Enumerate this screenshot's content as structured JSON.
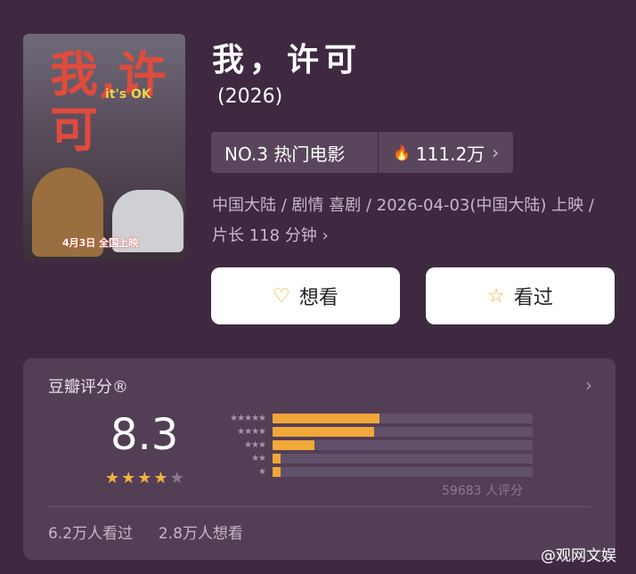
{
  "poster": {
    "title": "我,许可",
    "subtitle": "it's OK",
    "release_text": "4月3日 全国上映"
  },
  "movie": {
    "title": "我，许可",
    "year": "(2026)",
    "rank": "NO.3 热门电影",
    "heat": "111.2万",
    "info": "中国大陆 / 剧情 喜剧 / 2026-04-03(中国大陆) 上映 / 片长 118 分钟"
  },
  "actions": {
    "want": "想看",
    "seen": "看过"
  },
  "rating": {
    "label": "豆瓣评分®",
    "score": "8.3",
    "stars": 4,
    "distribution": [
      {
        "stars": "★★★★★",
        "fraction": 0.41
      },
      {
        "stars": "★★★★",
        "fraction": 0.39
      },
      {
        "stars": "★★★",
        "fraction": 0.16
      },
      {
        "stars": "★★",
        "fraction": 0.03
      },
      {
        "stars": "★",
        "fraction": 0.03
      }
    ],
    "count": "59683 人评分",
    "seen_count": "6.2万人看过",
    "want_count": "2.8万人想看"
  },
  "watermark": "@观网文娱",
  "colors": {
    "background": "#3f2941",
    "accent": "#f2a73a"
  }
}
